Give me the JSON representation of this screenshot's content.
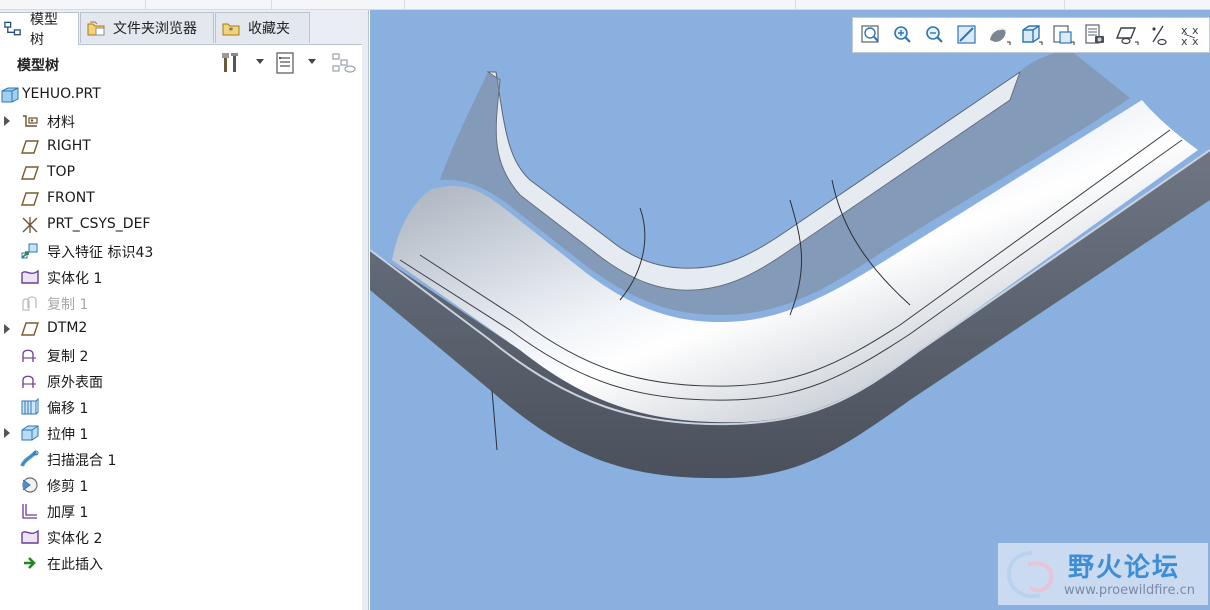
{
  "tabs": [
    {
      "label": "模型树",
      "icon": "model-tree-icon"
    },
    {
      "label": "文件夹浏览器",
      "icon": "folder-browser-icon"
    },
    {
      "label": "收藏夹",
      "icon": "favorites-icon"
    }
  ],
  "panel": {
    "title": "模型树",
    "buttons": [
      "tools-icon",
      "tree-settings-icon",
      "tree-filter-icon"
    ]
  },
  "tree": {
    "root": {
      "label": "YEHUO.PRT",
      "icon": "part-icon"
    },
    "items": [
      {
        "label": "材料",
        "icon": "material-icon",
        "expandable": true
      },
      {
        "label": "RIGHT",
        "icon": "datum-plane-icon",
        "expandable": false
      },
      {
        "label": "TOP",
        "icon": "datum-plane-icon",
        "expandable": false
      },
      {
        "label": "FRONT",
        "icon": "datum-plane-icon",
        "expandable": false
      },
      {
        "label": "PRT_CSYS_DEF",
        "icon": "coordinate-system-icon",
        "expandable": false
      },
      {
        "label": "导入特征 标识43",
        "icon": "import-feature-icon",
        "expandable": false
      },
      {
        "label": "实体化 1",
        "icon": "solidify-icon",
        "expandable": false
      },
      {
        "label": "复制 1",
        "icon": "copy-icon",
        "expandable": false,
        "dimmed": true
      },
      {
        "label": "DTM2",
        "icon": "datum-plane-icon",
        "expandable": true
      },
      {
        "label": "复制 2",
        "icon": "copy-icon",
        "expandable": false
      },
      {
        "label": "原外表面",
        "icon": "surface-icon",
        "expandable": false
      },
      {
        "label": "偏移 1",
        "icon": "offset-icon",
        "expandable": false
      },
      {
        "label": "拉伸 1",
        "icon": "extrude-icon",
        "expandable": true
      },
      {
        "label": "扫描混合 1",
        "icon": "swept-blend-icon",
        "expandable": false
      },
      {
        "label": "修剪 1",
        "icon": "trim-icon",
        "expandable": false
      },
      {
        "label": "加厚 1",
        "icon": "thicken-icon",
        "expandable": false
      },
      {
        "label": "实体化 2",
        "icon": "solidify-icon",
        "expandable": false
      },
      {
        "label": "在此插入",
        "icon": "insert-here-arrow-icon",
        "expandable": false
      }
    ]
  },
  "view_toolbar": [
    "refit-icon",
    "zoom-in-icon",
    "zoom-out-icon",
    "repaint-icon",
    "display-style-icon",
    "saved-views-icon",
    "view-manager-icon",
    "perspective-icon",
    "datum-display-icon",
    "spin-center-icon",
    "annotation-display-icon"
  ],
  "watermark": {
    "name": "野火论坛",
    "url": "www.proewildfire.cn"
  },
  "colors": {
    "viewport_bg": "#8ab0e0",
    "accent": "#3d8ed6"
  }
}
